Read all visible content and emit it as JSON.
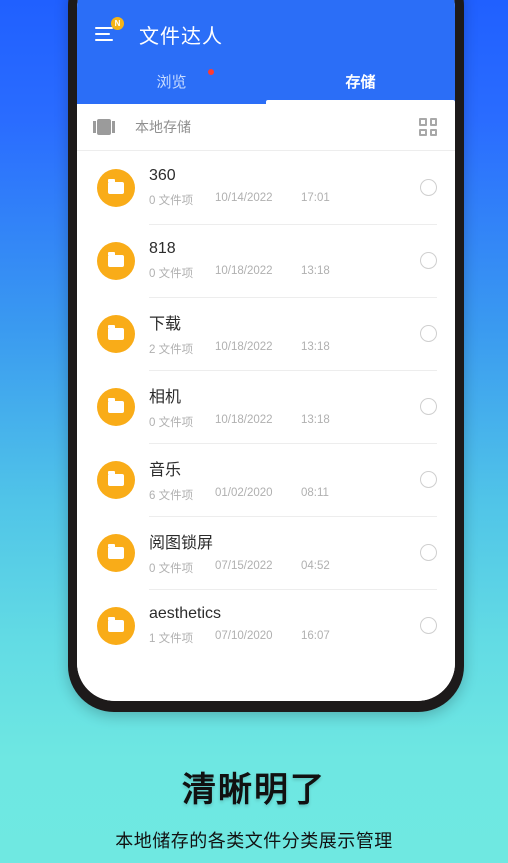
{
  "theme": {
    "accent_blue": "#2b6ef7",
    "folder_orange": "#f9ac18",
    "badge_yellow": "#f5b417",
    "dot_red": "#ff3b30",
    "bg_gradient_top": "#2060ff",
    "bg_gradient_bottom": "#6fe8e1"
  },
  "appbar": {
    "menu_icon": "hamburger-menu-icon",
    "menu_badge": "N",
    "title": "文件达人"
  },
  "tabs": [
    {
      "label": "浏览",
      "active": false,
      "has_dot": true
    },
    {
      "label": "存储",
      "active": true,
      "has_dot": false
    }
  ],
  "storage_header": {
    "icon": "memory-chip-icon",
    "label": "本地存储",
    "view_toggle_icon": "grid-view-icon"
  },
  "list": {
    "unit": "文件项",
    "items": [
      {
        "name": "360",
        "count": "0",
        "unit": "文件项",
        "date": "10/14/2022",
        "time": "17:01",
        "selected": false
      },
      {
        "name": "818",
        "count": "0",
        "unit": "文件项",
        "date": "10/18/2022",
        "time": "13:18",
        "selected": false
      },
      {
        "name": "下载",
        "count": "2",
        "unit": "文件项",
        "date": "10/18/2022",
        "time": "13:18",
        "selected": false
      },
      {
        "name": "相机",
        "count": "0",
        "unit": "文件项",
        "date": "10/18/2022",
        "time": "13:18",
        "selected": false
      },
      {
        "name": "音乐",
        "count": "6",
        "unit": "文件项",
        "date": "01/02/2020",
        "time": "08:11",
        "selected": false
      },
      {
        "name": "阅图锁屏",
        "count": "0",
        "unit": "文件项",
        "date": "07/15/2022",
        "time": "04:52",
        "selected": false
      },
      {
        "name": "aesthetics",
        "count": "1",
        "unit": "文件项",
        "date": "07/10/2020",
        "time": "16:07",
        "selected": false
      }
    ]
  },
  "caption": {
    "headline": "清晰明了",
    "subtext": "本地储存的各类文件分类展示管理"
  }
}
